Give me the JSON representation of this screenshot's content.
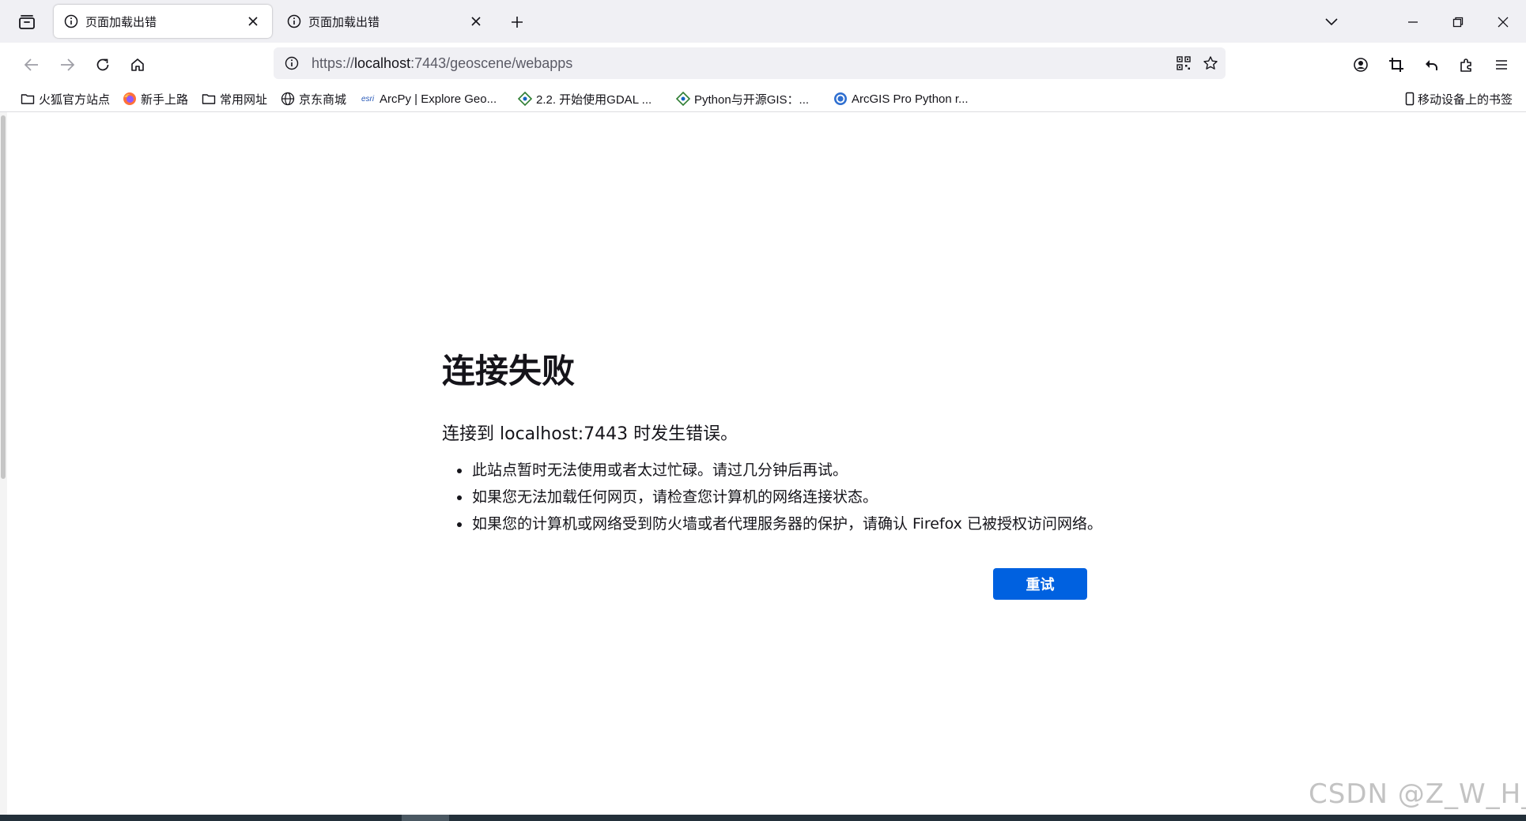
{
  "tabs": [
    {
      "title": "页面加载出错",
      "active": true
    },
    {
      "title": "页面加载出错",
      "active": false
    }
  ],
  "urlbar": {
    "scheme": "https://",
    "host": "localhost",
    "path": ":7443/geoscene/webapps"
  },
  "bookmarks": [
    {
      "label": "火狐官方站点",
      "icon": "folder-icon"
    },
    {
      "label": "新手上路",
      "icon": "firefox-icon"
    },
    {
      "label": "常用网址",
      "icon": "folder-icon"
    },
    {
      "label": "京东商城",
      "icon": "globe-icon"
    },
    {
      "label": "ArcPy | Explore Geo...",
      "icon": "esri-icon",
      "icon_text": "esri"
    },
    {
      "label": "2.2. 开始使用GDAL ...",
      "icon": "gdal-icon"
    },
    {
      "label": "Python与开源GIS：...",
      "icon": "gdal-icon"
    },
    {
      "label": "ArcGIS Pro Python r...",
      "icon": "arcgis-icon"
    }
  ],
  "mobile_bookmarks": "移动设备上的书签",
  "error": {
    "title": "连接失败",
    "description": "连接到 localhost:7443 时发生错误。",
    "items": [
      "此站点暂时无法使用或者太过忙碌。请过几分钟后再试。",
      "如果您无法加载任何网页，请检查您计算机的网络连接状态。",
      "如果您的计算机或网络受到防火墙或者代理服务器的保护，请确认 Firefox 已被授权访问网络。"
    ],
    "retry_label": "重试"
  },
  "watermark": "CSDN @Z_W_H_",
  "colors": {
    "primary_button": "#0061e0",
    "tab_strip": "#f0f0f4",
    "text": "#15141a"
  }
}
